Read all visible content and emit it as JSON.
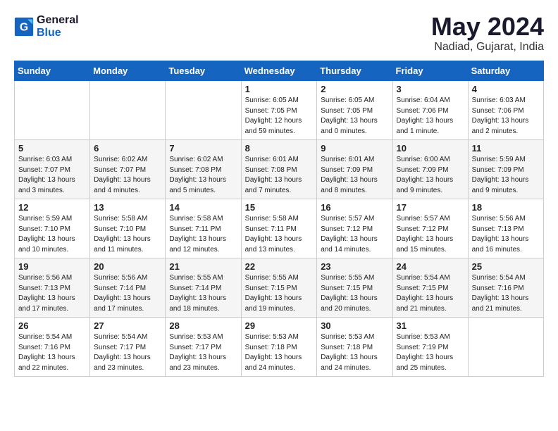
{
  "header": {
    "logo_line1": "General",
    "logo_line2": "Blue",
    "month_year": "May 2024",
    "location": "Nadiad, Gujarat, India"
  },
  "weekdays": [
    "Sunday",
    "Monday",
    "Tuesday",
    "Wednesday",
    "Thursday",
    "Friday",
    "Saturday"
  ],
  "weeks": [
    [
      {
        "day": "",
        "info": ""
      },
      {
        "day": "",
        "info": ""
      },
      {
        "day": "",
        "info": ""
      },
      {
        "day": "1",
        "info": "Sunrise: 6:05 AM\nSunset: 7:05 PM\nDaylight: 12 hours\nand 59 minutes."
      },
      {
        "day": "2",
        "info": "Sunrise: 6:05 AM\nSunset: 7:05 PM\nDaylight: 13 hours\nand 0 minutes."
      },
      {
        "day": "3",
        "info": "Sunrise: 6:04 AM\nSunset: 7:06 PM\nDaylight: 13 hours\nand 1 minute."
      },
      {
        "day": "4",
        "info": "Sunrise: 6:03 AM\nSunset: 7:06 PM\nDaylight: 13 hours\nand 2 minutes."
      }
    ],
    [
      {
        "day": "5",
        "info": "Sunrise: 6:03 AM\nSunset: 7:07 PM\nDaylight: 13 hours\nand 3 minutes."
      },
      {
        "day": "6",
        "info": "Sunrise: 6:02 AM\nSunset: 7:07 PM\nDaylight: 13 hours\nand 4 minutes."
      },
      {
        "day": "7",
        "info": "Sunrise: 6:02 AM\nSunset: 7:08 PM\nDaylight: 13 hours\nand 5 minutes."
      },
      {
        "day": "8",
        "info": "Sunrise: 6:01 AM\nSunset: 7:08 PM\nDaylight: 13 hours\nand 7 minutes."
      },
      {
        "day": "9",
        "info": "Sunrise: 6:01 AM\nSunset: 7:09 PM\nDaylight: 13 hours\nand 8 minutes."
      },
      {
        "day": "10",
        "info": "Sunrise: 6:00 AM\nSunset: 7:09 PM\nDaylight: 13 hours\nand 9 minutes."
      },
      {
        "day": "11",
        "info": "Sunrise: 5:59 AM\nSunset: 7:09 PM\nDaylight: 13 hours\nand 9 minutes."
      }
    ],
    [
      {
        "day": "12",
        "info": "Sunrise: 5:59 AM\nSunset: 7:10 PM\nDaylight: 13 hours\nand 10 minutes."
      },
      {
        "day": "13",
        "info": "Sunrise: 5:58 AM\nSunset: 7:10 PM\nDaylight: 13 hours\nand 11 minutes."
      },
      {
        "day": "14",
        "info": "Sunrise: 5:58 AM\nSunset: 7:11 PM\nDaylight: 13 hours\nand 12 minutes."
      },
      {
        "day": "15",
        "info": "Sunrise: 5:58 AM\nSunset: 7:11 PM\nDaylight: 13 hours\nand 13 minutes."
      },
      {
        "day": "16",
        "info": "Sunrise: 5:57 AM\nSunset: 7:12 PM\nDaylight: 13 hours\nand 14 minutes."
      },
      {
        "day": "17",
        "info": "Sunrise: 5:57 AM\nSunset: 7:12 PM\nDaylight: 13 hours\nand 15 minutes."
      },
      {
        "day": "18",
        "info": "Sunrise: 5:56 AM\nSunset: 7:13 PM\nDaylight: 13 hours\nand 16 minutes."
      }
    ],
    [
      {
        "day": "19",
        "info": "Sunrise: 5:56 AM\nSunset: 7:13 PM\nDaylight: 13 hours\nand 17 minutes."
      },
      {
        "day": "20",
        "info": "Sunrise: 5:56 AM\nSunset: 7:14 PM\nDaylight: 13 hours\nand 17 minutes."
      },
      {
        "day": "21",
        "info": "Sunrise: 5:55 AM\nSunset: 7:14 PM\nDaylight: 13 hours\nand 18 minutes."
      },
      {
        "day": "22",
        "info": "Sunrise: 5:55 AM\nSunset: 7:15 PM\nDaylight: 13 hours\nand 19 minutes."
      },
      {
        "day": "23",
        "info": "Sunrise: 5:55 AM\nSunset: 7:15 PM\nDaylight: 13 hours\nand 20 minutes."
      },
      {
        "day": "24",
        "info": "Sunrise: 5:54 AM\nSunset: 7:15 PM\nDaylight: 13 hours\nand 21 minutes."
      },
      {
        "day": "25",
        "info": "Sunrise: 5:54 AM\nSunset: 7:16 PM\nDaylight: 13 hours\nand 21 minutes."
      }
    ],
    [
      {
        "day": "26",
        "info": "Sunrise: 5:54 AM\nSunset: 7:16 PM\nDaylight: 13 hours\nand 22 minutes."
      },
      {
        "day": "27",
        "info": "Sunrise: 5:54 AM\nSunset: 7:17 PM\nDaylight: 13 hours\nand 23 minutes."
      },
      {
        "day": "28",
        "info": "Sunrise: 5:53 AM\nSunset: 7:17 PM\nDaylight: 13 hours\nand 23 minutes."
      },
      {
        "day": "29",
        "info": "Sunrise: 5:53 AM\nSunset: 7:18 PM\nDaylight: 13 hours\nand 24 minutes."
      },
      {
        "day": "30",
        "info": "Sunrise: 5:53 AM\nSunset: 7:18 PM\nDaylight: 13 hours\nand 24 minutes."
      },
      {
        "day": "31",
        "info": "Sunrise: 5:53 AM\nSunset: 7:19 PM\nDaylight: 13 hours\nand 25 minutes."
      },
      {
        "day": "",
        "info": ""
      }
    ]
  ]
}
